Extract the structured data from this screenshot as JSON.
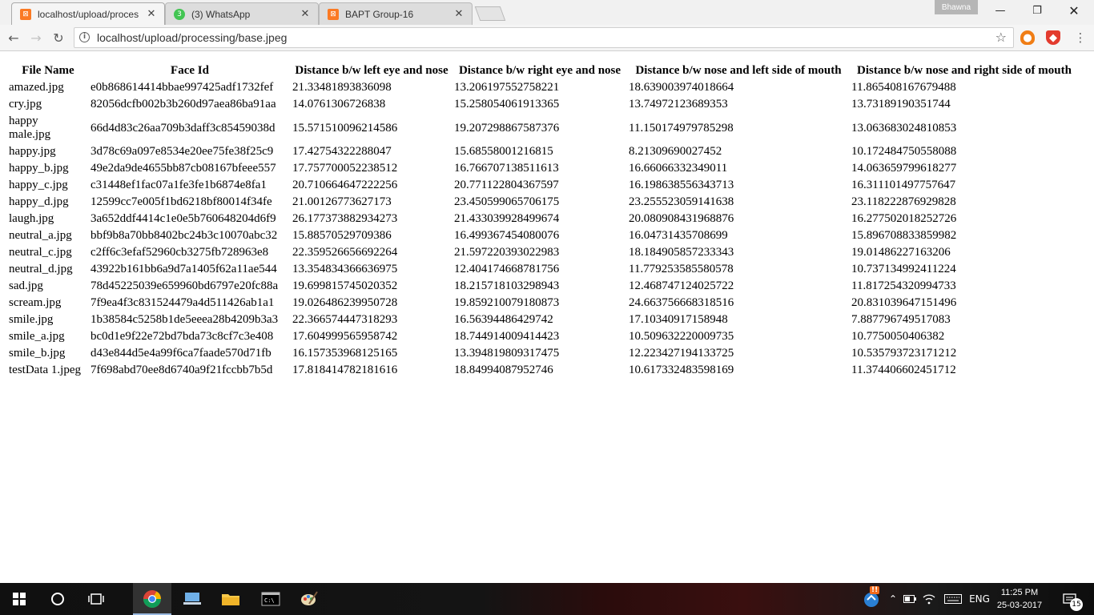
{
  "browser": {
    "tabs": [
      {
        "title": "localhost/upload/proces",
        "icon": "xampp-icon",
        "active": true
      },
      {
        "title": "(3) WhatsApp",
        "icon": "whatsapp-icon",
        "active": false
      },
      {
        "title": "BAPT Group-16",
        "icon": "xampp-icon",
        "active": false
      }
    ],
    "profile_name": "Bhawna",
    "url": "localhost/upload/processing/base.jpeg",
    "colors": {
      "xampp": "#fb7a24",
      "whatsapp": "#43c553",
      "brave": "#e33b2e",
      "fire": "#f07d15"
    }
  },
  "table": {
    "headers": [
      "File Name",
      "Face Id",
      "Distance b/w left eye and nose",
      "Distance b/w right eye and nose",
      "Distance b/w nose and left side of mouth",
      "Distance b/w nose and right side of mouth"
    ],
    "rows": [
      [
        "amazed.jpg",
        "e0b868614414bbae997425adf1732fef",
        "21.33481893836098",
        "13.206197552758221",
        "18.639003974018664",
        "11.865408167679488"
      ],
      [
        "cry.jpg",
        "82056dcfb002b3b260d97aea86ba91aa",
        "14.0761306726838",
        "15.258054061913365",
        "13.74972123689353",
        "13.73189190351744"
      ],
      [
        "happy male.jpg",
        "66d4d83c26aa709b3daff3c85459038d",
        "15.571510096214586",
        "19.207298867587376",
        "11.150174979785298",
        "13.063683024810853"
      ],
      [
        "happy.jpg",
        "3d78c69a097e8534e20ee75fe38f25c9",
        "17.42754322288047",
        "15.68558001216815",
        "8.21309690027452",
        "10.172484750558088"
      ],
      [
        "happy_b.jpg",
        "49e2da9de4655bb87cb08167bfeee557",
        "17.757700052238512",
        "16.76670713851161 3",
        "16.66066332349011",
        "14.063659799618277"
      ],
      [
        "happy_c.jpg",
        "c31448ef1fac07a1fe3fe1b6874e8fa1",
        "20.710664647222256",
        "20.771122804367597",
        "16.198638556343713",
        "16.311101497757647"
      ],
      [
        "happy_d.jpg",
        "12599cc7e005f1bd6218bf80014f34fe",
        "21.00126773627173",
        "23.450599065706175",
        "23.255523059141638",
        "23.118222876929828"
      ],
      [
        "laugh.jpg",
        "3a652ddf4414c1e0e5b760648204d6f9",
        "26.177373882934273",
        "21.433039928499674",
        "20.080908431968876",
        "16.277502018252726"
      ],
      [
        "neutral_a.jpg",
        "bbf9b8a70bb8402bc24b3c10070abc32",
        "15.88570529709386",
        "16.499367454080076",
        "16.04731435708699",
        "15.896708833859982"
      ],
      [
        "neutral_c.jpg",
        "c2ff6c3efaf52960cb3275fb728963e8",
        "22.359526656692264",
        "21.597220393022983",
        "18.184905857233343",
        "19.01486227163206"
      ],
      [
        "neutral_d.jpg",
        "43922b161bb6a9d7a1405f62a11ae544",
        "13.354834366636975",
        "12.404174668781756",
        "11.779253585580578",
        "10.737134992411224"
      ],
      [
        "sad.jpg",
        "78d45225039e659960bd6797e20fc88a",
        "19.699815745020352",
        "18.215718103298943",
        "12.468747124025722",
        "11.817254320994733"
      ],
      [
        "scream.jpg",
        "7f9ea4f3c831524479a4d511426ab1a1",
        "19.026486239950728",
        "19.859210079180873",
        "24.663756668318516",
        "20.831039647151496"
      ],
      [
        "smile.jpg",
        "1b38584c5258b1de5eeea28b4209b3a3",
        "22.366574447318293",
        "16.56394486429742",
        "17.10340917158948",
        "7.887796749517083"
      ],
      [
        "smile_a.jpg",
        "bc0d1e9f22e72bd7bda73c8cf7c3e408",
        "17.604999565958742",
        "18.744914009414423",
        "10.509632220009735",
        "10.7750050406382"
      ],
      [
        "smile_b.jpg",
        "d43e844d5e4a99f6ca7faade570d71fb",
        "16.157353968125165",
        "13.394819809317475",
        "12.223427194133725",
        "10.535793723171212"
      ],
      [
        "testData 1.jpeg",
        "7f698abd70ee8d6740a9f21fccbb7b5d",
        "17.818414782181616",
        "18.84994087952746",
        "10.617332483598169",
        "11.374406602451712"
      ]
    ]
  },
  "taskbar": {
    "language": "ENG",
    "time": "11:25 PM",
    "date": "25-03-2017",
    "notification_count": "15",
    "alert_badge": "!!"
  }
}
